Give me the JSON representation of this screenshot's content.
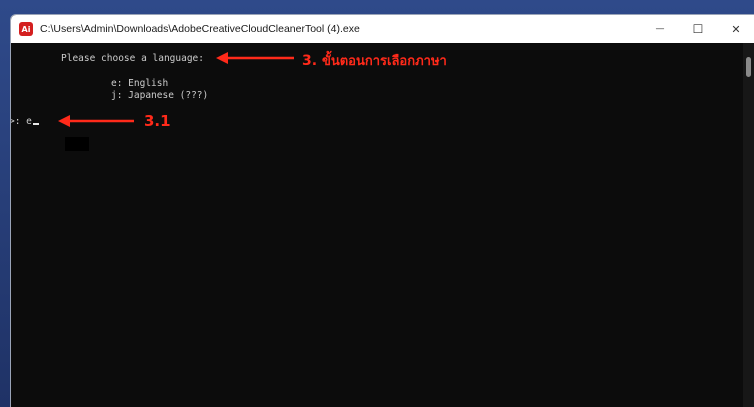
{
  "window": {
    "title": "C:\\Users\\Admin\\Downloads\\AdobeCreativeCloudCleanerTool (4).exe",
    "app_icon_label": "Ai",
    "minimize_symbol": "—",
    "maximize_symbol": "☐",
    "close_symbol": "✕"
  },
  "console": {
    "prompt_heading": "Please choose a language:",
    "options": [
      "e: English",
      "j: Japanese (???)"
    ],
    "input_prompt": ">: ",
    "input_value": "e"
  },
  "annotations": {
    "step3_number": "3.",
    "step3_text": "ขั้นตอนการเลือกภาษา",
    "step31": "3.1",
    "color": "#ff2a1a"
  },
  "icons": [
    "app-icon",
    "minimize-icon",
    "maximize-icon",
    "close-icon",
    "arrow-icon"
  ]
}
